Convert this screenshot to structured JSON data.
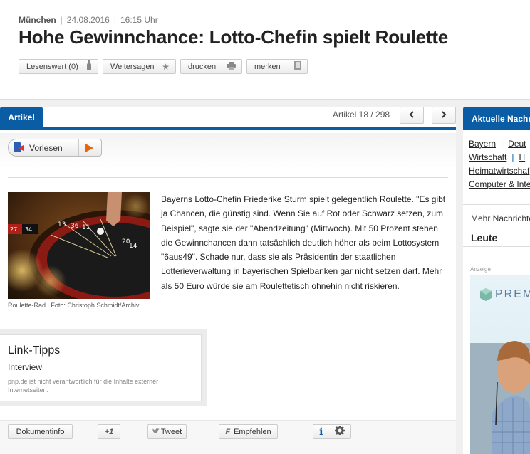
{
  "article": {
    "location": "München",
    "date": "24.08.2016",
    "time": "16:15 Uhr",
    "title": "Hohe Gewinnchance: Lotto-Chefin spielt Roulette",
    "tools": {
      "lesenswert": "Lesenswert (0)",
      "weitersagen": "Weitersagen",
      "drucken": "drucken",
      "merken": "merken"
    },
    "tab_label": "Artikel",
    "counter": "Artikel 18 / 298",
    "vorlesen": "Vorlesen",
    "image_caption": "Roulette-Rad | Foto: Christoph Schmidt/Archiv",
    "body": "Bayerns Lotto-Chefin Friederike Sturm spielt gelegentlich Roulette. \"Es gibt ja Chancen, die günstig sind. Wenn Sie auf Rot oder Schwarz setzen, zum Beispiel\", sagte sie der \"Abendzeitung\" (Mittwoch). Mit 50 Prozent stehen die Gewinnchancen dann tatsächlich deutlich höher als beim Lottosystem \"6aus49\". Schade nur, dass sie als Präsidentin der staatlichen Lotterieverwaltung in bayerischen Spielbanken gar nicht setzen darf. Mehr als 50 Euro würde sie am Roulettetisch ohnehin nicht riskieren."
  },
  "link_tips": {
    "title": "Link-Tipps",
    "link": "Interview",
    "note": "pnp.de ist nicht verantwortlich für die Inhalte externer Internetseiten."
  },
  "bottom": {
    "dokumentinfo": "Dokumentinfo",
    "plus_one": "+1",
    "tweet": "Tweet",
    "empfehlen": "Empfehlen",
    "info": "i"
  },
  "sidebar": {
    "head": "Aktuelle Nachr",
    "links": [
      "Bayern",
      "Deut",
      "Wirtschaft",
      "H",
      "Heimatwirtschaf",
      "Computer & Inte"
    ],
    "more_label": "Mehr Nachrichte",
    "more_value": "Leute",
    "ad_label": "Anzeige",
    "ad_brand": "PREM"
  },
  "icons": {
    "lesenswert": "bottle-icon",
    "weitersagen": "star-icon",
    "drucken": "printer-icon",
    "merken": "bookmark-icon",
    "prev": "chevron-left-icon",
    "next": "chevron-right-icon",
    "vorlesen": "speaker-icon",
    "play": "play-icon",
    "settings": "gear-icon"
  },
  "colors": {
    "brand_blue": "#0a5da5",
    "play_orange": "#e8650c"
  }
}
